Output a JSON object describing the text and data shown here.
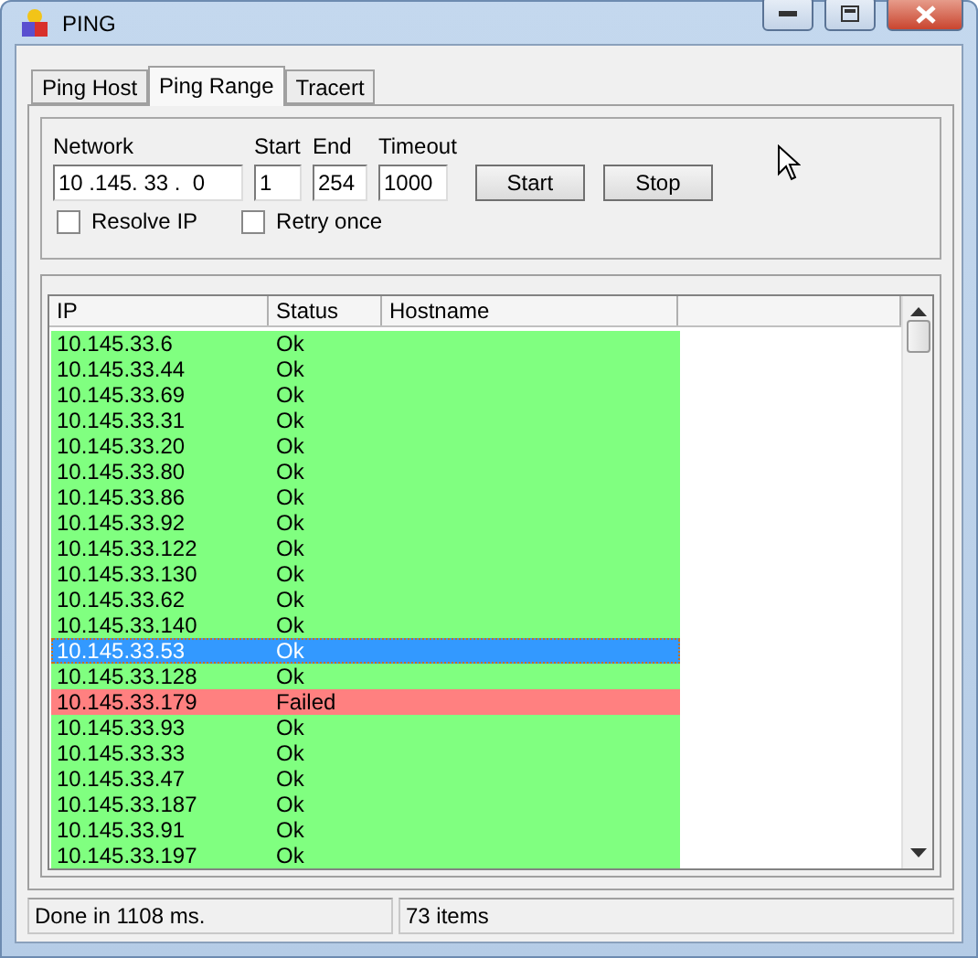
{
  "window": {
    "title": "PING"
  },
  "tabs": [
    {
      "label": "Ping Host",
      "selected": false
    },
    {
      "label": "Ping Range",
      "selected": true
    },
    {
      "label": "Tracert",
      "selected": false
    }
  ],
  "form": {
    "network": {
      "label": "Network",
      "value": "10 .145. 33 .  0"
    },
    "start": {
      "label": "Start",
      "value": "1"
    },
    "end": {
      "label": "End",
      "value": "254"
    },
    "timeout": {
      "label": "Timeout",
      "value": "1000"
    },
    "buttons": [
      "Start",
      "Stop"
    ],
    "checkboxes": [
      {
        "label": "Resolve IP",
        "checked": false
      },
      {
        "label": "Retry once",
        "checked": false
      }
    ]
  },
  "table": {
    "columns": [
      "IP",
      "Status",
      "Hostname"
    ],
    "rows": [
      {
        "ip": "10.145.33.6",
        "status": "Ok",
        "kind": "ok",
        "selected": false
      },
      {
        "ip": "10.145.33.44",
        "status": "Ok",
        "kind": "ok",
        "selected": false
      },
      {
        "ip": "10.145.33.69",
        "status": "Ok",
        "kind": "ok",
        "selected": false
      },
      {
        "ip": "10.145.33.31",
        "status": "Ok",
        "kind": "ok",
        "selected": false
      },
      {
        "ip": "10.145.33.20",
        "status": "Ok",
        "kind": "ok",
        "selected": false
      },
      {
        "ip": "10.145.33.80",
        "status": "Ok",
        "kind": "ok",
        "selected": false
      },
      {
        "ip": "10.145.33.86",
        "status": "Ok",
        "kind": "ok",
        "selected": false
      },
      {
        "ip": "10.145.33.92",
        "status": "Ok",
        "kind": "ok",
        "selected": false
      },
      {
        "ip": "10.145.33.122",
        "status": "Ok",
        "kind": "ok",
        "selected": false
      },
      {
        "ip": "10.145.33.130",
        "status": "Ok",
        "kind": "ok",
        "selected": false
      },
      {
        "ip": "10.145.33.62",
        "status": "Ok",
        "kind": "ok",
        "selected": false
      },
      {
        "ip": "10.145.33.140",
        "status": "Ok",
        "kind": "ok",
        "selected": false
      },
      {
        "ip": "10.145.33.53",
        "status": "Ok",
        "selected": true
      },
      {
        "ip": "10.145.33.128",
        "status": "Ok",
        "kind": "ok",
        "selected": false
      },
      {
        "ip": "10.145.33.179",
        "status": "Failed",
        "kind": "failed",
        "selected": false
      },
      {
        "ip": "10.145.33.93",
        "status": "Ok",
        "kind": "ok",
        "selected": false
      },
      {
        "ip": "10.145.33.33",
        "status": "Ok",
        "kind": "ok",
        "selected": false
      },
      {
        "ip": "10.145.33.47",
        "status": "Ok",
        "kind": "ok",
        "selected": false
      },
      {
        "ip": "10.145.33.187",
        "status": "Ok",
        "kind": "ok",
        "selected": false
      },
      {
        "ip": "10.145.33.91",
        "status": "Ok",
        "kind": "ok",
        "selected": false
      },
      {
        "ip": "10.145.33.197",
        "status": "Ok",
        "kind": "ok",
        "selected": false
      }
    ]
  },
  "status_bar": [
    "Done in 1108 ms.",
    "73 items"
  ]
}
